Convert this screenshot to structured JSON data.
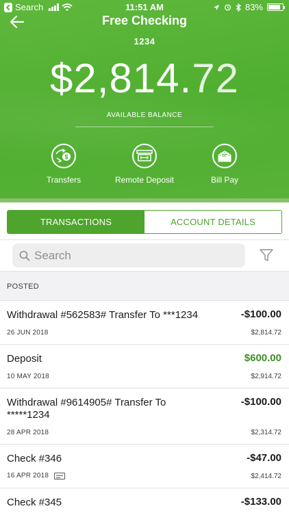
{
  "status_bar": {
    "carrier": "Search",
    "time": "11:51 AM",
    "battery": "83%",
    "battery_level": 0.83
  },
  "header": {
    "title": "Free Checking",
    "account_number": "1234",
    "balance_main": "$2,814.",
    "balance_cents": "72",
    "balance_label": "AVAILABLE BALANCE"
  },
  "actions": [
    {
      "label": "Transfers",
      "icon": "transfer-icon"
    },
    {
      "label": "Remote Deposit",
      "icon": "check-deposit-icon"
    },
    {
      "label": "Bill Pay",
      "icon": "envelope-icon"
    }
  ],
  "tabs": {
    "transactions": "TRANSACTIONS",
    "account_details": "ACCOUNT DETAILS",
    "active": "transactions"
  },
  "search": {
    "placeholder": "Search",
    "value": ""
  },
  "section": {
    "title": "POSTED"
  },
  "transactions": [
    {
      "description": "Withdrawal #562583# Transfer To ***1234",
      "amount": "-$100.00",
      "date": "26 JUN 2018",
      "running_balance": "$2,814.72",
      "type": "debit"
    },
    {
      "description": "Deposit",
      "amount": "$600.00",
      "date": "10 MAY 2018",
      "running_balance": "$2,914.72",
      "type": "credit"
    },
    {
      "description": "Withdrawal #9614905# Transfer To *****1234",
      "amount": "-$100.00",
      "date": "28 APR 2018",
      "running_balance": "$2,314.72",
      "type": "debit"
    },
    {
      "description": "Check #346",
      "amount": "-$47.00",
      "date": "16 APR 2018",
      "running_balance": "$2,414.72",
      "type": "debit",
      "has_check_image": true
    },
    {
      "description": "Check #345",
      "amount": "-$133.00",
      "date": "",
      "running_balance": "",
      "type": "debit"
    }
  ],
  "colors": {
    "brand_green": "#4ea42d",
    "credit_green": "#3f8f22"
  }
}
